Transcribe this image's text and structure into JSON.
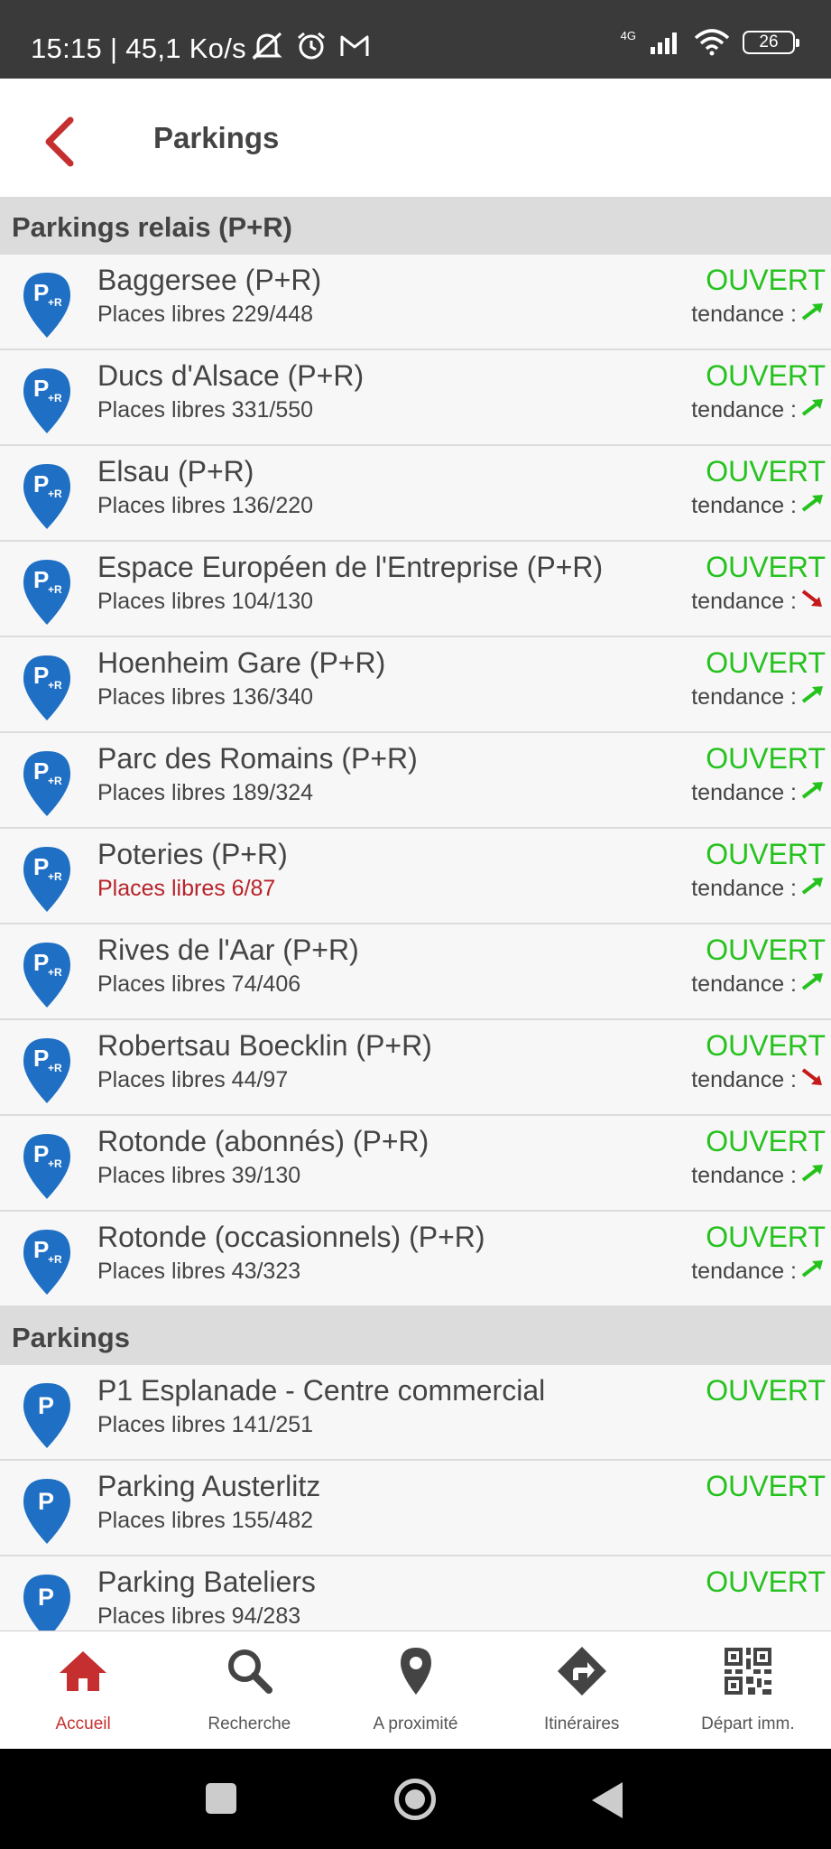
{
  "status_bar": {
    "time": "15:15 | 45,1 Ko/s",
    "network": "4G",
    "battery": "26",
    "icons": [
      "muted-bell-icon",
      "alarm-icon",
      "gmail-icon",
      "signal-icon",
      "wifi-icon",
      "battery-icon"
    ]
  },
  "app_bar": {
    "title": "Parkings",
    "back_icon": "chevron-left-icon",
    "accent": "#c62f2f"
  },
  "sections": [
    {
      "title": "Parkings relais (P+R)",
      "items": [
        {
          "name": " Baggersee (P+R)",
          "places": "Places libres 229/448",
          "status": "OUVERT",
          "trend_label": "tendance :",
          "trend": "up"
        },
        {
          "name": "Ducs d'Alsace (P+R)",
          "places": "Places libres 331/550",
          "status": "OUVERT",
          "trend_label": "tendance :",
          "trend": "up"
        },
        {
          "name": "Elsau (P+R)",
          "places": "Places libres 136/220",
          "status": "OUVERT",
          "trend_label": "tendance :",
          "trend": "up"
        },
        {
          "name": "Espace Européen de l'Entreprise (P+R)",
          "places": "Places libres 104/130",
          "status": "OUVERT",
          "trend_label": "tendance :",
          "trend": "down"
        },
        {
          "name": "Hoenheim Gare (P+R)",
          "places": "Places libres 136/340",
          "status": "OUVERT",
          "trend_label": "tendance :",
          "trend": "up"
        },
        {
          "name": "Parc des Romains (P+R)",
          "places": "Places libres 189/324",
          "status": "OUVERT",
          "trend_label": "tendance :",
          "trend": "up"
        },
        {
          "name": "Poteries (P+R)",
          "places": "Places libres 6/87",
          "status": "OUVERT",
          "trend_label": "tendance :",
          "trend": "up",
          "low": true
        },
        {
          "name": "Rives de l'Aar (P+R)",
          "places": "Places libres 74/406",
          "status": "OUVERT",
          "trend_label": "tendance :",
          "trend": "up"
        },
        {
          "name": "Robertsau Boecklin (P+R)",
          "places": "Places libres 44/97",
          "status": "OUVERT",
          "trend_label": "tendance :",
          "trend": "down"
        },
        {
          "name": "Rotonde (abonnés) (P+R)",
          "places": "Places libres 39/130",
          "status": "OUVERT",
          "trend_label": "tendance :",
          "trend": "up"
        },
        {
          "name": "Rotonde (occasionnels) (P+R)",
          "places": "Places libres 43/323",
          "status": "OUVERT",
          "trend_label": "tendance :",
          "trend": "up"
        }
      ]
    },
    {
      "title": "Parkings",
      "items": [
        {
          "name": "P1 Esplanade - Centre commercial",
          "places": "Places libres 141/251",
          "status": "OUVERT"
        },
        {
          "name": "Parking Austerlitz",
          "places": "Places libres 155/482",
          "status": "OUVERT"
        },
        {
          "name": "Parking Bateliers",
          "places": "Places libres 94/283",
          "status": "OUVERT"
        }
      ]
    }
  ],
  "colors": {
    "open": "#25c21e",
    "trend_up": "#25c21e",
    "trend_down": "#c41a1a",
    "low_places": "#b8232a",
    "pin": "#1f6fc4"
  },
  "bottom_nav": [
    {
      "label": "Accueil",
      "icon": "home-icon",
      "active": true
    },
    {
      "label": "Recherche",
      "icon": "search-icon",
      "active": false
    },
    {
      "label": "A proximité",
      "icon": "location-pin-icon",
      "active": false
    },
    {
      "label": "Itinéraires",
      "icon": "directions-icon",
      "active": false
    },
    {
      "label": "Départ imm.",
      "icon": "qr-code-icon",
      "active": false
    }
  ]
}
